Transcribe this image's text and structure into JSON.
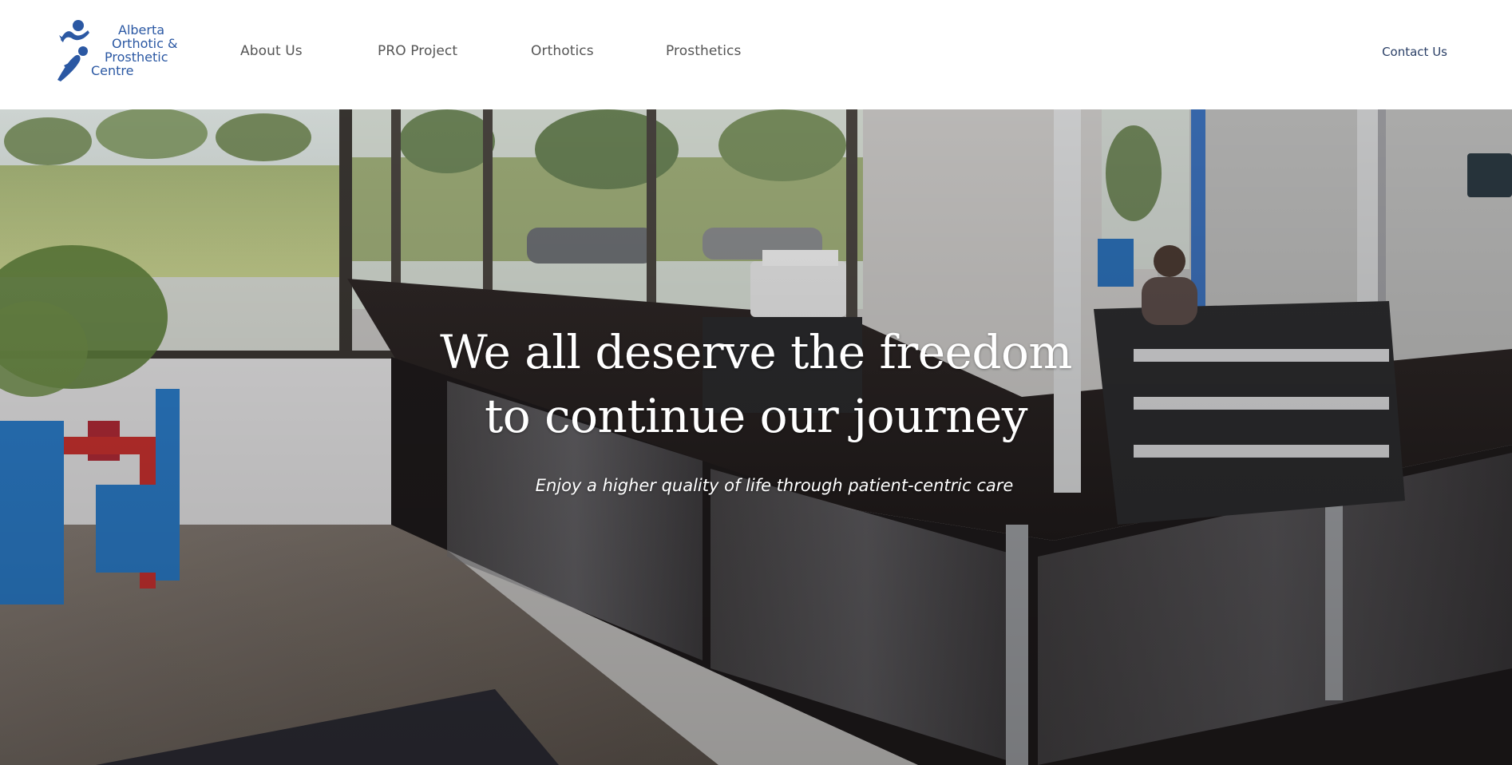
{
  "header": {
    "logo": {
      "lines": [
        "Alberta",
        "Orthotic &",
        "Prosthetic",
        "Centre"
      ],
      "icon": "running-figures-logo-icon",
      "color": "#2b58a3"
    },
    "nav": [
      {
        "label": "About Us"
      },
      {
        "label": "PRO Project"
      },
      {
        "label": "Orthotics"
      },
      {
        "label": "Prosthetics"
      }
    ],
    "contact_label": "Contact Us"
  },
  "hero": {
    "title_lines": [
      "We all deserve the freedom",
      "to continue our journey"
    ],
    "subtitle": "Enjoy a higher quality of life through patient-centric care",
    "background": "clinic-reception-photo"
  }
}
